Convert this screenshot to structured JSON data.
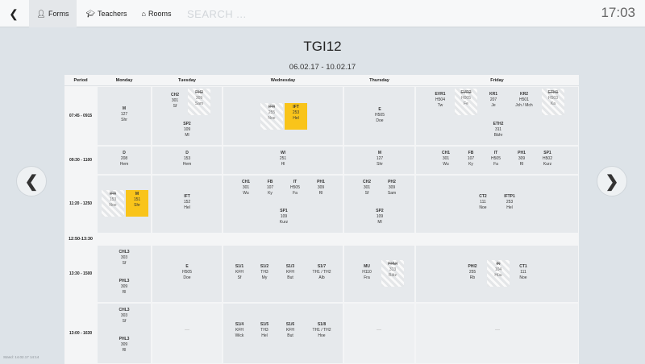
{
  "nav": {
    "tabs": [
      {
        "label": "Forms",
        "icon": "user-icon"
      },
      {
        "label": "Teachers",
        "icon": "graduation-cap-icon"
      },
      {
        "label": "Rooms",
        "icon": "home-icon"
      }
    ],
    "search_placeholder": "SEARCH ...",
    "clock": "17:03"
  },
  "title": "TGI12",
  "date_range": "06.02.17 - 10.02.17",
  "columns": [
    "Period",
    "Monday",
    "Tuesday",
    "Wednesday",
    "Thursday",
    "Friday"
  ],
  "periods": [
    {
      "label": "07:45 - 0915"
    },
    {
      "label": "09:30 - 1100"
    },
    {
      "label": "11:20 - 1250"
    },
    {
      "label": "12:50-13:30"
    },
    {
      "label": "13:30 - 1500"
    },
    {
      "label": "13:00 - 1630"
    }
  ],
  "empty_marker": "---",
  "lessons": [
    {
      "subject": "M",
      "room": "127",
      "teacher": "Shr",
      "state": "normal"
    },
    {
      "subject": "CH2",
      "room": "301",
      "teacher": "Sf",
      "state": "normal"
    },
    {
      "subject": "PH2",
      "room": "309",
      "teacher": "Sam",
      "state": "cancelled"
    },
    {
      "subject": "SP2",
      "room": "109",
      "teacher": "Ml",
      "state": "normal"
    },
    {
      "subject": "IFR",
      "room": "255",
      "teacher": "Noe",
      "state": "cancelled"
    },
    {
      "subject": "IFT",
      "room": "253",
      "teacher": "Hel",
      "state": "highlight"
    },
    {
      "subject": "E",
      "room": "H505",
      "teacher": "Doe",
      "state": "normal"
    },
    {
      "subject": "EVR1",
      "room": "H504",
      "teacher": "Tw",
      "state": "normal"
    },
    {
      "subject": "EVR2",
      "room": "H005",
      "teacher": "Fe",
      "state": "cancelled"
    },
    {
      "subject": "KR1",
      "room": "207",
      "teacher": "Je",
      "state": "normal"
    },
    {
      "subject": "KR2",
      "room": "H501",
      "teacher": "Jch / Mch",
      "state": "normal"
    },
    {
      "subject": "ETH1",
      "room": "H503",
      "teacher": "Ka",
      "state": "cancelled"
    },
    {
      "subject": "ETH2",
      "room": "311",
      "teacher": "Bähr",
      "state": "normal"
    },
    {
      "subject": "D",
      "room": "208",
      "teacher": "Hem",
      "state": "normal"
    },
    {
      "subject": "D",
      "room": "153",
      "teacher": "Hem",
      "state": "normal"
    },
    {
      "subject": "WI",
      "room": "251",
      "teacher": "Hl",
      "state": "normal"
    },
    {
      "subject": "M",
      "room": "127",
      "teacher": "Shr",
      "state": "normal"
    },
    {
      "subject": "CH1",
      "room": "301",
      "teacher": "Wu",
      "state": "normal"
    },
    {
      "subject": "FB",
      "room": "107",
      "teacher": "Ky",
      "state": "normal"
    },
    {
      "subject": "IT",
      "room": "H505",
      "teacher": "Fa",
      "state": "normal"
    },
    {
      "subject": "PH1",
      "room": "309",
      "teacher": "Rl",
      "state": "normal"
    },
    {
      "subject": "SP1",
      "room": "H502",
      "teacher": "Kurz",
      "state": "normal"
    },
    {
      "subject": "IFR",
      "room": "153",
      "teacher": "Noe",
      "state": "cancelled"
    },
    {
      "subject": "M",
      "room": "151",
      "teacher": "Shr",
      "state": "highlight"
    },
    {
      "subject": "IFT",
      "room": "152",
      "teacher": "Hel",
      "state": "normal"
    },
    {
      "subject": "CH1",
      "room": "301",
      "teacher": "Wu",
      "state": "normal"
    },
    {
      "subject": "FB",
      "room": "107",
      "teacher": "Ky",
      "state": "normal"
    },
    {
      "subject": "IT",
      "room": "H505",
      "teacher": "Fa",
      "state": "normal"
    },
    {
      "subject": "PH1",
      "room": "309",
      "teacher": "Rl",
      "state": "normal"
    },
    {
      "subject": "SP1",
      "room": "109",
      "teacher": "Kurz",
      "state": "normal"
    },
    {
      "subject": "CH2",
      "room": "301",
      "teacher": "Sf",
      "state": "normal"
    },
    {
      "subject": "PH2",
      "room": "309",
      "teacher": "Sam",
      "state": "normal"
    },
    {
      "subject": "SP2",
      "room": "109",
      "teacher": "Ml",
      "state": "normal"
    },
    {
      "subject": "CT2",
      "room": "111",
      "teacher": "Noe",
      "state": "normal"
    },
    {
      "subject": "IFTP1",
      "room": "253",
      "teacher": "Hel",
      "state": "normal"
    },
    {
      "subject": "CHL3",
      "room": "303",
      "teacher": "Sf",
      "state": "normal"
    },
    {
      "subject": "PHL3",
      "room": "309",
      "teacher": "Rl",
      "state": "normal"
    },
    {
      "subject": "E",
      "room": "H505",
      "teacher": "Doe",
      "state": "normal"
    },
    {
      "subject": "S1/1",
      "room": "KFH",
      "teacher": "Sf",
      "state": "normal"
    },
    {
      "subject": "S1/2",
      "room": "TH3",
      "teacher": "My",
      "state": "normal"
    },
    {
      "subject": "S1/3",
      "room": "KFH",
      "teacher": "But",
      "state": "normal"
    },
    {
      "subject": "S1/7",
      "room": "TH1 / TH2",
      "teacher": "Alb",
      "state": "normal"
    },
    {
      "subject": "MU",
      "room": "H110",
      "teacher": "Fra",
      "state": "normal"
    },
    {
      "subject": "PHUI",
      "room": "313",
      "teacher": "Bätz",
      "state": "cancelled"
    },
    {
      "subject": "PHI2",
      "room": "255",
      "teacher": "Rb",
      "state": "normal"
    },
    {
      "subject": "IN",
      "room": "104",
      "teacher": "Hüu",
      "state": "cancelled"
    },
    {
      "subject": "CT1",
      "room": "111",
      "teacher": "Noe",
      "state": "normal"
    },
    {
      "subject": "CHL3",
      "room": "303",
      "teacher": "Sf",
      "state": "normal"
    },
    {
      "subject": "PHL3",
      "room": "309",
      "teacher": "Rl",
      "state": "normal"
    },
    {
      "subject": "S1/4",
      "room": "KFH",
      "teacher": "Wick",
      "state": "normal"
    },
    {
      "subject": "S1/5",
      "room": "TH3",
      "teacher": "Hel",
      "state": "normal"
    },
    {
      "subject": "S1/6",
      "room": "KFH",
      "teacher": "But",
      "state": "normal"
    },
    {
      "subject": "S1/8",
      "room": "TH1 / TH2",
      "teacher": "Hoe",
      "state": "normal"
    }
  ],
  "footer": {
    "stand": "Stand: 14.02.17 14:14"
  }
}
